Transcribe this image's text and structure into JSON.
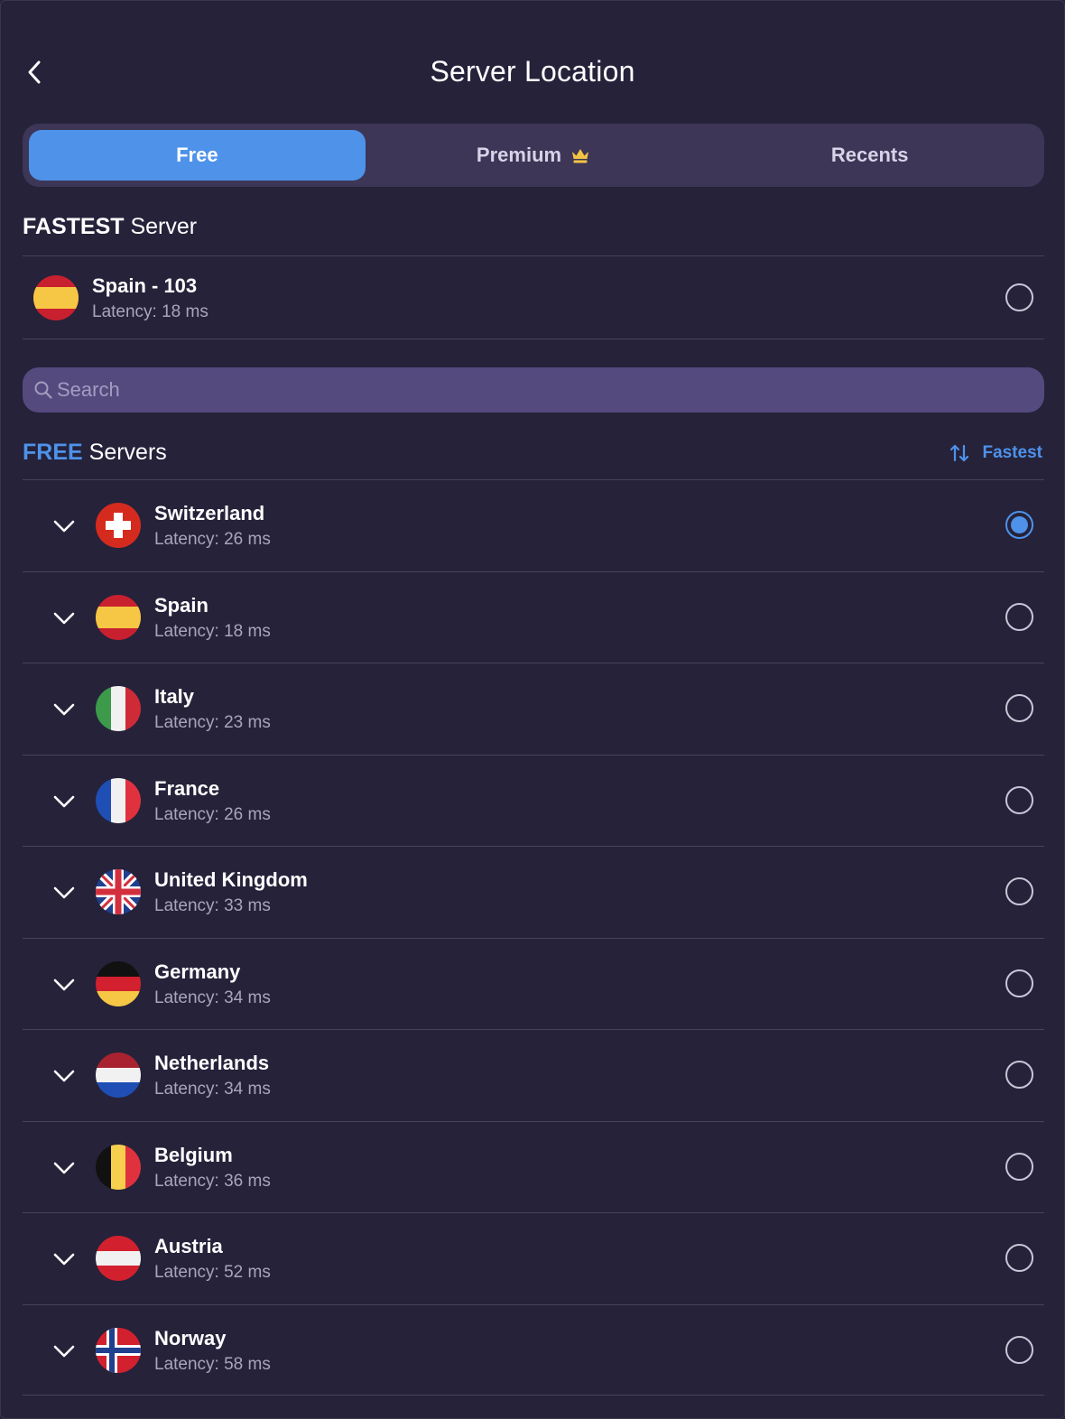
{
  "header": {
    "title": "Server Location"
  },
  "tabs": [
    {
      "label": "Free",
      "active": true
    },
    {
      "label": "Premium",
      "icon": "crown-icon"
    },
    {
      "label": "Recents"
    }
  ],
  "fastest": {
    "title_bold": "FASTEST",
    "title_rest": "Server",
    "server": {
      "name": "Spain - 103",
      "latency": "Latency: 18 ms",
      "flag": "spain-flag-icon",
      "selected": false
    }
  },
  "search": {
    "placeholder": "Search",
    "value": ""
  },
  "free": {
    "title_bold": "FREE",
    "title_rest": "Servers",
    "sort_label": "Fastest",
    "servers": [
      {
        "name": "Switzerland",
        "latency": "Latency: 26 ms",
        "flag": "switzerland-flag-icon",
        "selected": true
      },
      {
        "name": "Spain",
        "latency": "Latency: 18 ms",
        "flag": "spain-flag-icon",
        "selected": false
      },
      {
        "name": "Italy",
        "latency": "Latency: 23 ms",
        "flag": "italy-flag-icon",
        "selected": false
      },
      {
        "name": "France",
        "latency": "Latency: 26 ms",
        "flag": "france-flag-icon",
        "selected": false
      },
      {
        "name": "United Kingdom",
        "latency": "Latency: 33 ms",
        "flag": "uk-flag-icon",
        "selected": false
      },
      {
        "name": "Germany",
        "latency": "Latency: 34 ms",
        "flag": "germany-flag-icon",
        "selected": false
      },
      {
        "name": "Netherlands",
        "latency": "Latency: 34 ms",
        "flag": "netherlands-flag-icon",
        "selected": false
      },
      {
        "name": "Belgium",
        "latency": "Latency: 36 ms",
        "flag": "belgium-flag-icon",
        "selected": false
      },
      {
        "name": "Austria",
        "latency": "Latency: 52 ms",
        "flag": "austria-flag-icon",
        "selected": false
      },
      {
        "name": "Norway",
        "latency": "Latency: 58 ms",
        "flag": "norway-flag-icon",
        "selected": false
      }
    ]
  },
  "colors": {
    "background": "#25223a",
    "accent": "#4e92ea",
    "tab_bar": "#3d3657",
    "search_bg": "#554a7e",
    "crown": "#f2c443"
  }
}
